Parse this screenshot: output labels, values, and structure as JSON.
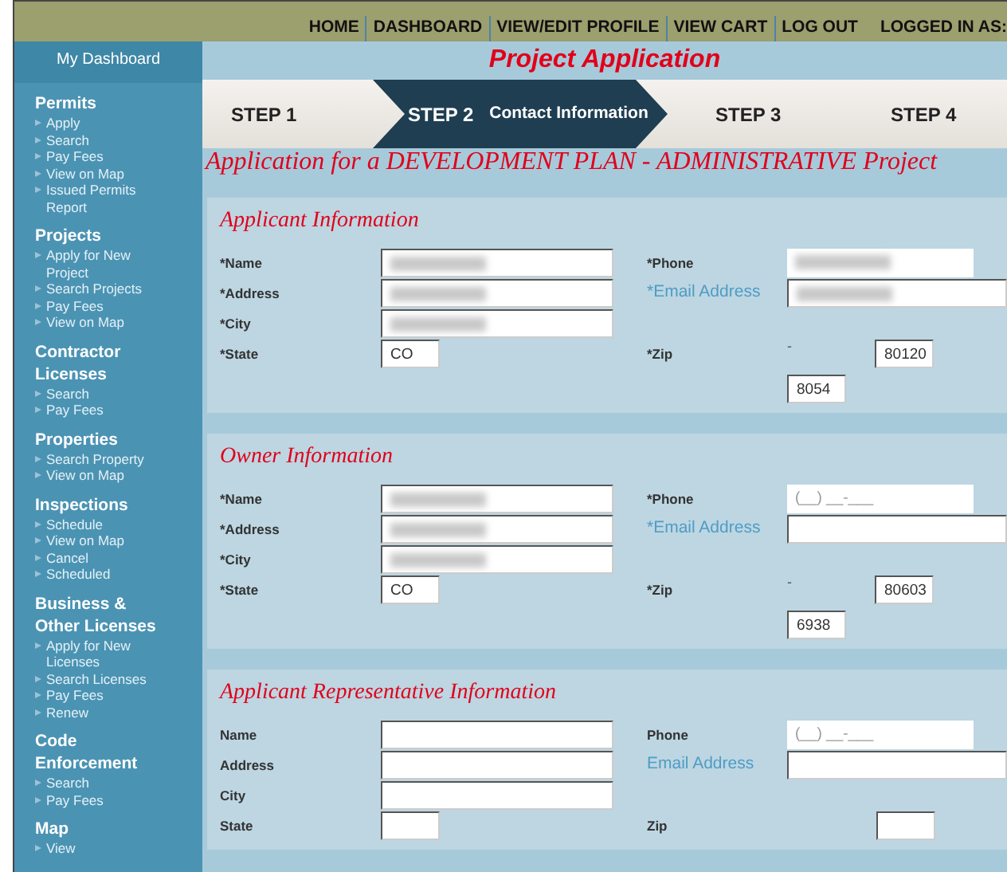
{
  "top_nav": {
    "links": [
      "HOME",
      "DASHBOARD",
      "VIEW/EDIT PROFILE",
      "VIEW CART",
      "LOG OUT"
    ],
    "logged_in_label": "LOGGED IN AS:"
  },
  "sidebar": {
    "header": "My Dashboard",
    "sections": [
      {
        "title": "Permits",
        "items": [
          "Apply",
          "Search",
          "Pay Fees",
          "View on Map",
          "Issued Permits Report"
        ]
      },
      {
        "title": "Projects",
        "items": [
          "Apply for New Project",
          "Search Projects",
          "Pay Fees",
          "View on Map"
        ]
      },
      {
        "title": "Contractor Licenses",
        "items": [
          "Search",
          "Pay Fees"
        ]
      },
      {
        "title": "Properties",
        "items": [
          "Search Property",
          "View on Map"
        ]
      },
      {
        "title": "Inspections",
        "items": [
          "Schedule",
          "View on Map",
          "Cancel",
          "Scheduled"
        ]
      },
      {
        "title": "Business & Other Licenses",
        "items": [
          "Apply for New Licenses",
          "Search Licenses",
          "Pay Fees",
          "Renew"
        ]
      },
      {
        "title": "Code Enforcement",
        "items": [
          "Search",
          "Pay Fees"
        ]
      },
      {
        "title": "Map",
        "items": [
          "View"
        ]
      }
    ]
  },
  "page_title": "Project Application",
  "steps": [
    {
      "label": "STEP 1",
      "selected": false
    },
    {
      "label": "STEP 2",
      "detail": "Contact Information",
      "selected": true
    },
    {
      "label": "STEP 3",
      "selected": false
    },
    {
      "label": "STEP 4",
      "selected": false
    }
  ],
  "subtitle": "Application for a DEVELOPMENT PLAN - ADMINISTRATIVE Project",
  "sections": [
    {
      "title": "Applicant Information",
      "rows": [
        {
          "left": {
            "label": "*Name",
            "kind": "text",
            "redacted": true
          },
          "right": {
            "label": "*Phone",
            "kind": "phone",
            "redacted": true
          }
        },
        {
          "left": {
            "label": "*Address",
            "kind": "text",
            "redacted": true
          },
          "right": {
            "label": "*Email Address",
            "kind": "email",
            "redacted": true
          }
        },
        {
          "left": {
            "label": "*City",
            "kind": "text",
            "redacted": true
          },
          "right": null
        },
        {
          "left": {
            "label": "*State",
            "kind": "short",
            "value": "CO"
          },
          "right": {
            "label": "*Zip",
            "kind": "zip",
            "separator": "-",
            "value": "80120",
            "extension": "8054"
          }
        }
      ]
    },
    {
      "title": "Owner Information",
      "rows": [
        {
          "left": {
            "label": "*Name",
            "kind": "text",
            "redacted": true
          },
          "right": {
            "label": "*Phone",
            "kind": "phone",
            "placeholder": "(__) __-___"
          }
        },
        {
          "left": {
            "label": "*Address",
            "kind": "text",
            "redacted": true
          },
          "right": {
            "label": "*Email Address",
            "kind": "email"
          }
        },
        {
          "left": {
            "label": "*City",
            "kind": "text",
            "redacted": true
          },
          "right": null
        },
        {
          "left": {
            "label": "*State",
            "kind": "short",
            "value": "CO"
          },
          "right": {
            "label": "*Zip",
            "kind": "zip",
            "separator": "-",
            "value": "80603",
            "extension": "6938"
          }
        }
      ]
    },
    {
      "title": "Applicant Representative Information",
      "rows": [
        {
          "left": {
            "label": "Name",
            "kind": "text"
          },
          "right": {
            "label": "Phone",
            "kind": "phone",
            "placeholder": "(__) __-___"
          }
        },
        {
          "left": {
            "label": "Address",
            "kind": "text"
          },
          "right": {
            "label": "Email Address",
            "kind": "email"
          }
        },
        {
          "left": {
            "label": "City",
            "kind": "text"
          },
          "right": null
        },
        {
          "left": {
            "label": "State",
            "kind": "short"
          },
          "right": {
            "label": "Zip",
            "kind": "zip"
          }
        }
      ]
    }
  ]
}
